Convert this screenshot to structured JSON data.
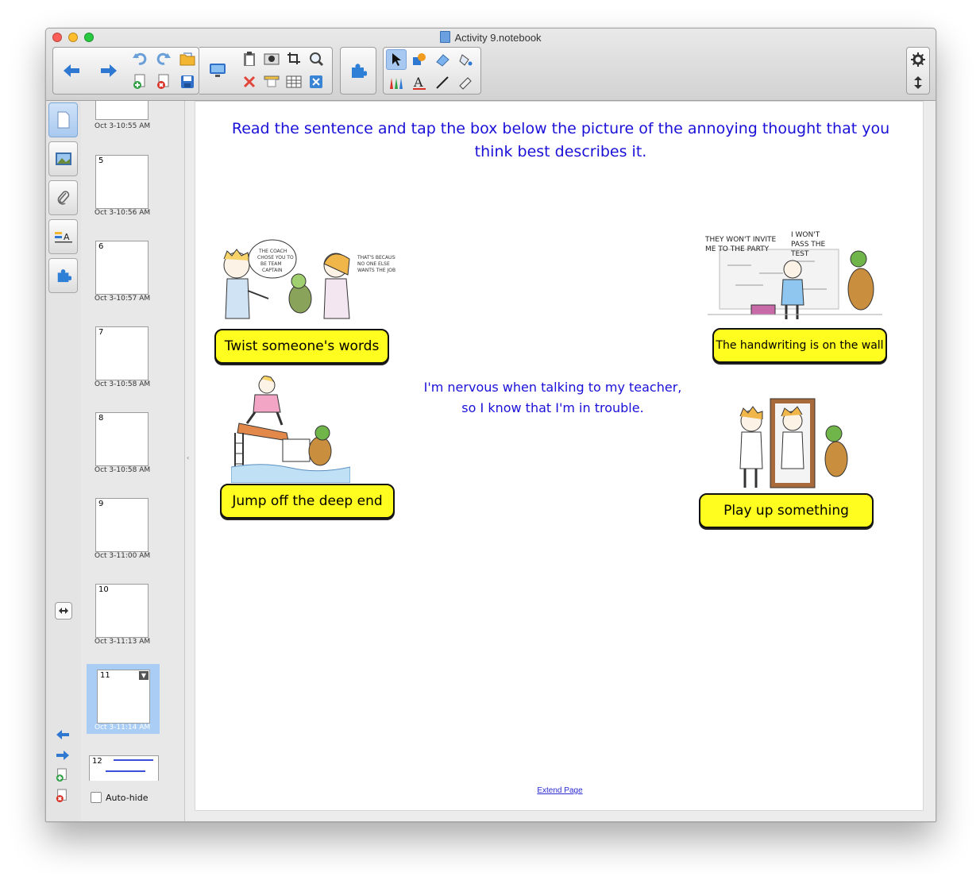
{
  "window": {
    "title": "Activity 9.notebook",
    "colors": {
      "close": "#ff5f57",
      "minimize": "#ffbd2e",
      "zoom": "#28c940"
    }
  },
  "toolbar": {
    "nav": [
      "back-arrow-icon",
      "forward-arrow-icon"
    ],
    "edit_icons": [
      "undo-icon",
      "redo-icon",
      "open-folder-icon",
      "add-page-icon",
      "delete-page-icon",
      "save-icon"
    ],
    "view_icons": [
      "display-icon",
      "paste-icon",
      "screen-capture-icon",
      "crop-icon",
      "clear-icon",
      "screen-shade-icon",
      "table-icon",
      "close-box-icon",
      "magnifier-icon"
    ],
    "addon_icon": "puzzle-icon",
    "tool_icons": [
      "select-arrow-icon",
      "shapes-icon",
      "eraser-icon",
      "fill-icon",
      "pens-icon",
      "text-icon",
      "line-icon",
      "magic-pen-icon"
    ],
    "right_icons": [
      "gear-icon",
      "vertical-arrows-icon"
    ]
  },
  "sidebar_tabs": [
    "page-sorter-icon",
    "gallery-icon",
    "attachments-icon",
    "properties-icon",
    "addons-icon"
  ],
  "sorter": {
    "pages": [
      {
        "num": "",
        "label": "Oct 3-10:55 AM"
      },
      {
        "num": "5",
        "label": "Oct 3-10:56 AM"
      },
      {
        "num": "6",
        "label": "Oct 3-10:57 AM"
      },
      {
        "num": "7",
        "label": "Oct 3-10:58 AM"
      },
      {
        "num": "8",
        "label": "Oct 3-10:58 AM"
      },
      {
        "num": "9",
        "label": "Oct 3-11:00 AM"
      },
      {
        "num": "10",
        "label": "Oct 3-11:13 AM"
      },
      {
        "num": "11",
        "label": "Oct 3-11:14 AM"
      },
      {
        "num": "12",
        "label": ""
      }
    ],
    "selected_page": "11",
    "autohide_label": "Auto-hide",
    "resize_icon": "resize-horizontal-icon"
  },
  "page": {
    "instruction": "Read the sentence and tap the box below the picture of the annoying thought that you think best describes it.",
    "sentence": "I'm nervous when talking to my teacher, so I know that I'm in trouble.",
    "answers": {
      "twist": "Twist someone's words",
      "handwriting": "The handwriting is on the wall",
      "jump": "Jump off the deep end",
      "play": "Play up something"
    },
    "cartoon_text": {
      "coach": "THE COACH CHOSE YOU TO BE TEAM CAPTAIN",
      "because": "THAT'S BECAUSE NO ONE ELSE WANTS THE JOB.",
      "invite": "THEY WON'T INVITE ME TO THE PARTY",
      "pass": "I WON'T PASS THE TEST"
    },
    "extend_label": "Extend Page",
    "accent_colors": {
      "text_blue": "#1a10d8",
      "answer_yellow": "#fffc1f"
    }
  }
}
